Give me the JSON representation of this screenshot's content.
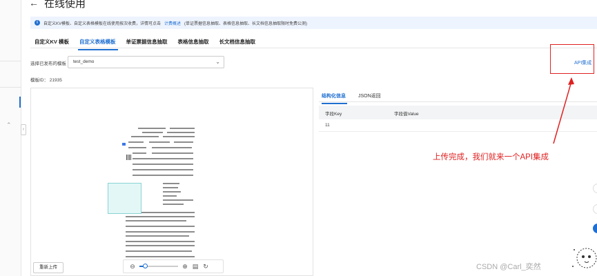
{
  "page": {
    "title": "在线使用",
    "back_icon": "arrow-left-icon"
  },
  "info_bar": {
    "text": "自定义KV模板、自定义表格模板在线使用按次收费，详情可点击",
    "link": "计费概述",
    "suffix": "(单证票据信息抽取、表格信息抽取、长文档信息抽取限时免费公测)"
  },
  "tabs": [
    {
      "label": "自定义KV 模板",
      "active": false
    },
    {
      "label": "自定义表格模板",
      "active": true
    },
    {
      "label": "单证票据信息抽取",
      "active": false
    },
    {
      "label": "表格信息抽取",
      "active": false
    },
    {
      "label": "长文档信息抽取",
      "active": false
    }
  ],
  "template": {
    "label": "选择已发布的模板",
    "selected": "test_demo",
    "id_text": "模板ID： 21935"
  },
  "api_link": "API集成",
  "preview": {
    "reupload": "重新上传"
  },
  "result": {
    "tabs": [
      "结构化信息",
      "JSON返回"
    ],
    "active_tab": 0,
    "columns": [
      "字段Key",
      "字段值Value"
    ],
    "rows": [
      [
        "11",
        ""
      ]
    ]
  },
  "annotation": "上传完成，我们就来一个API集成",
  "watermark": "CSDN @Carl_奕然",
  "colors": {
    "accent": "#1f6fd1",
    "annotation": "#e02020",
    "info_bg": "#eef4fe"
  }
}
